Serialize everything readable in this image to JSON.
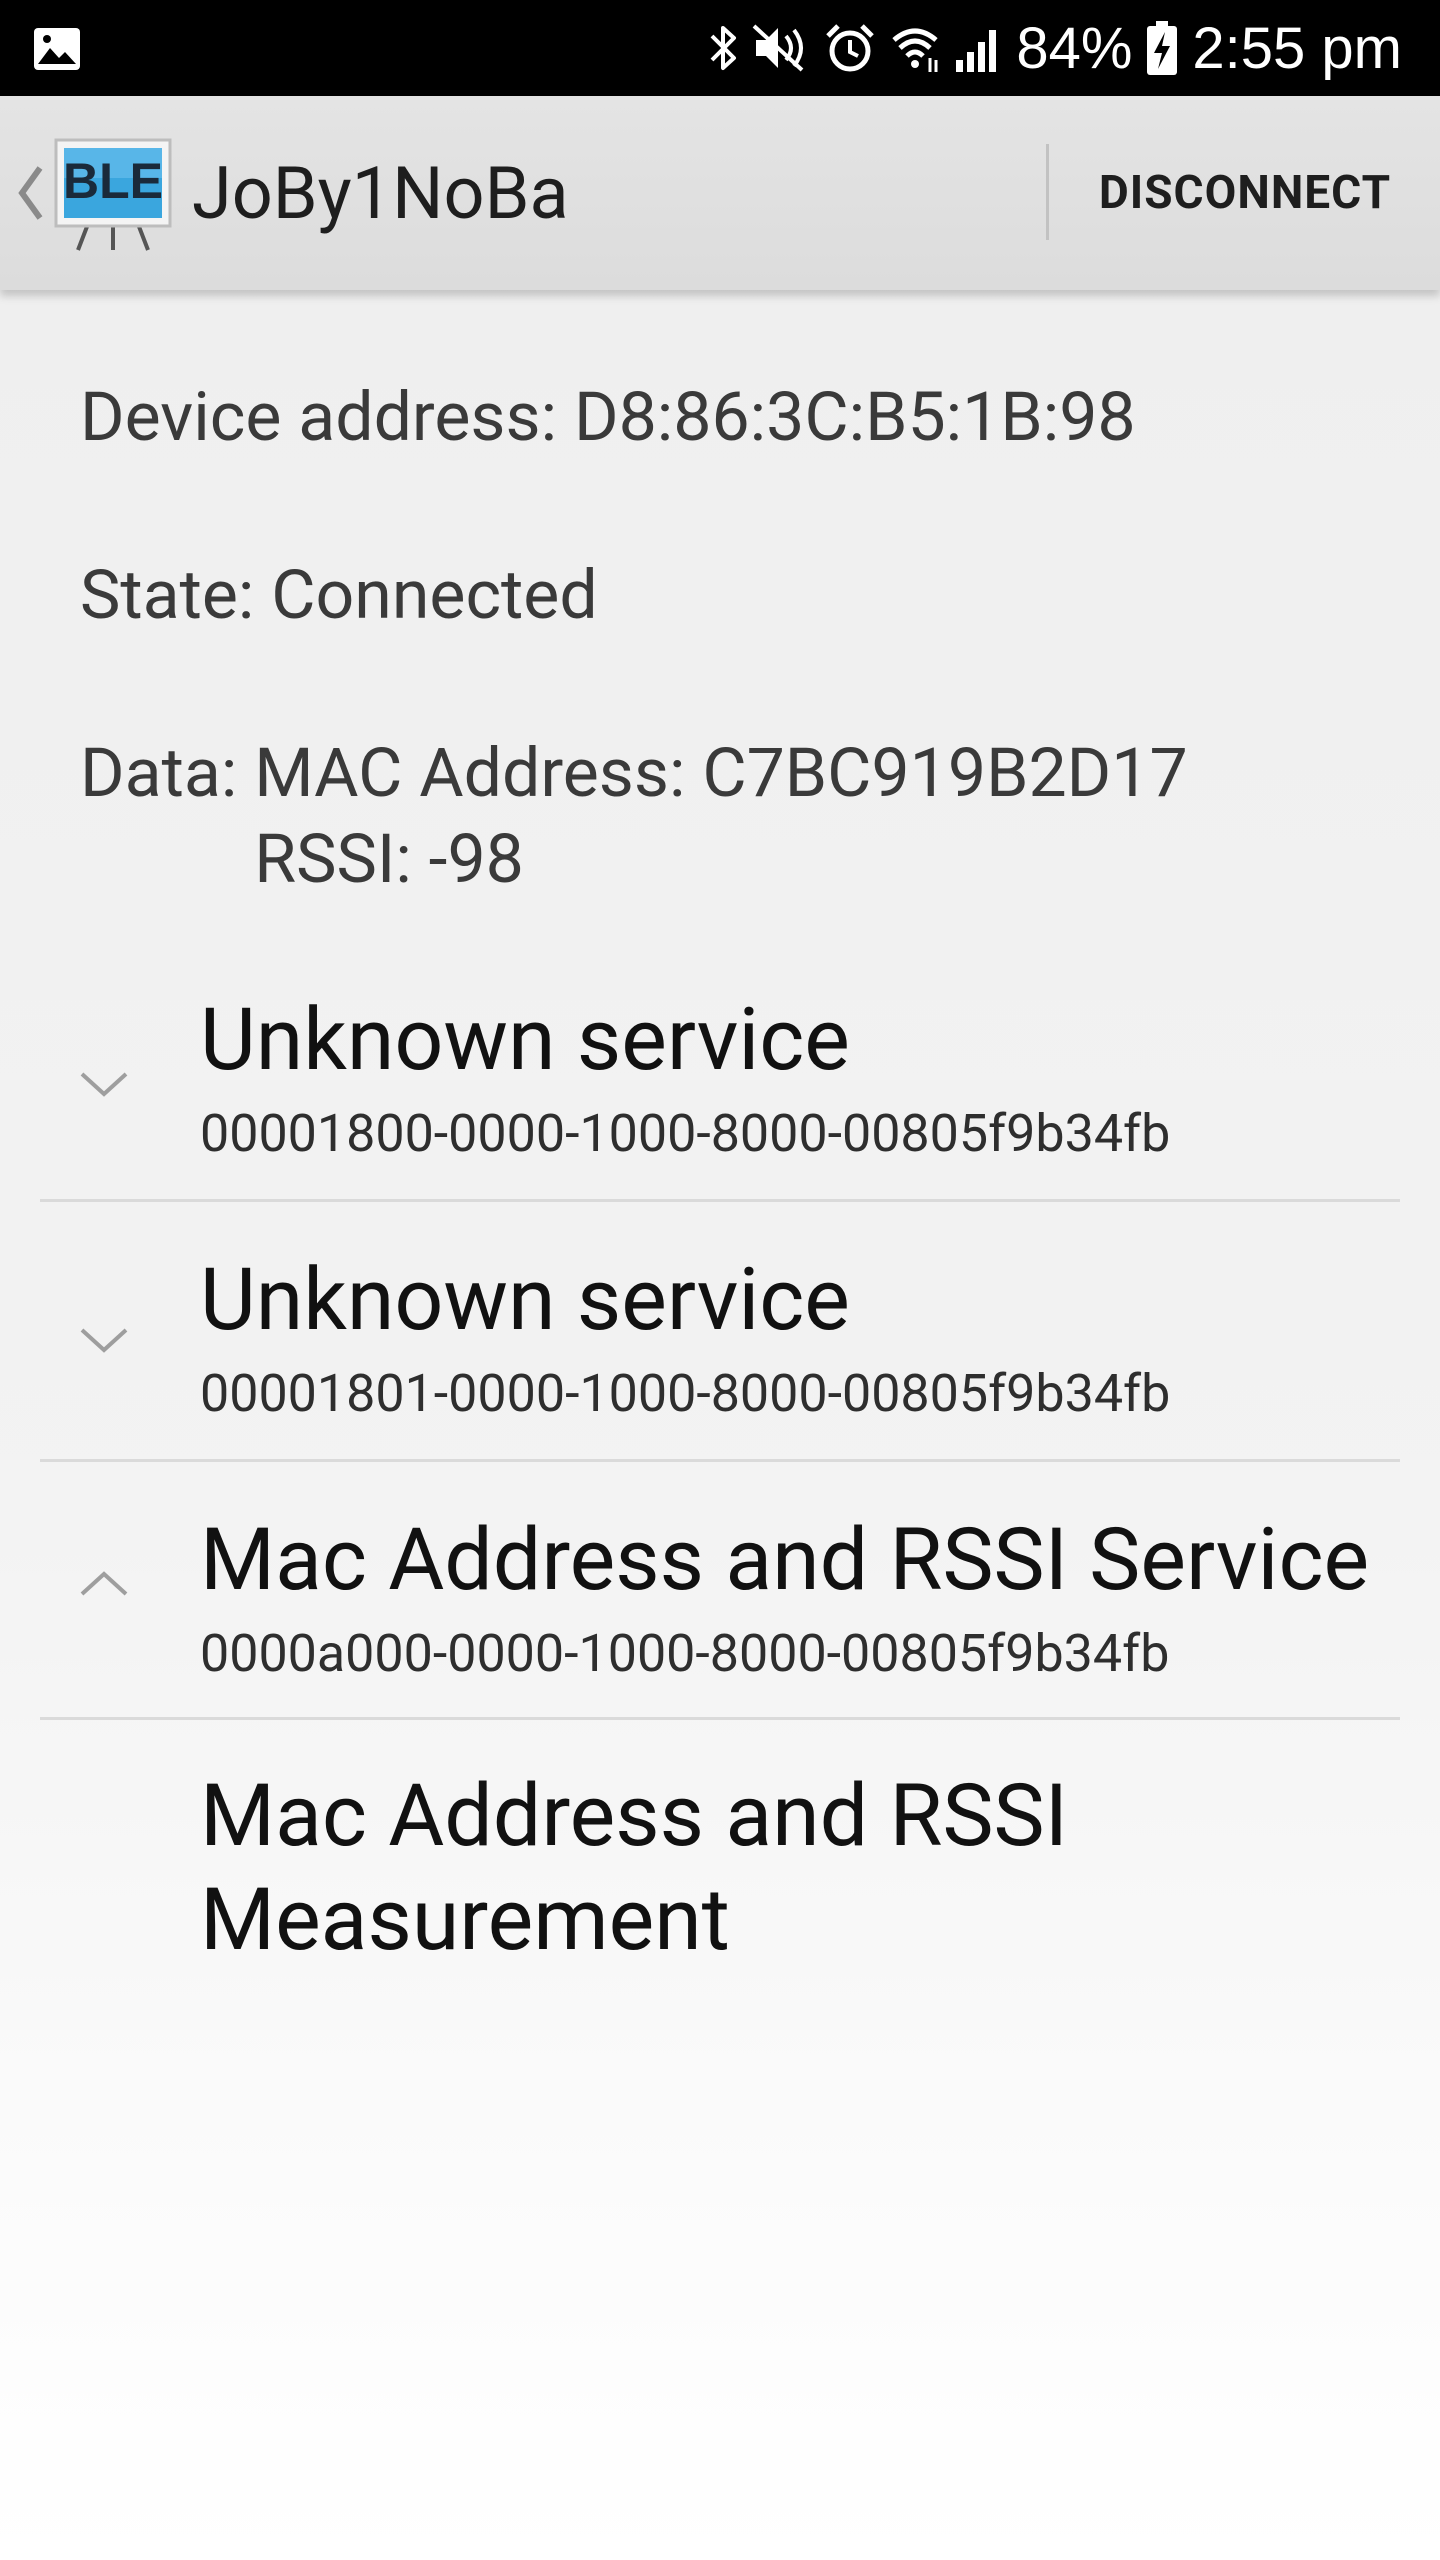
{
  "status_bar": {
    "battery": "84%",
    "time": "2:55 pm",
    "icons": [
      "gallery-icon",
      "bluetooth-icon",
      "mute-icon",
      "alarm-icon",
      "wifi-icon",
      "signal-icon",
      "battery-charging-icon"
    ]
  },
  "action_bar": {
    "logo_text": "BLE",
    "title": "JoBy1NoBa",
    "disconnect_label": "DISCONNECT"
  },
  "device": {
    "address_label": "Device address: ",
    "address": "D8:86:3C:B5:1B:98",
    "state_label": "State: ",
    "state": "Connected",
    "data_label": "Data: ",
    "data_line1": "MAC Address: C7BC919B2D17",
    "data_line2": "RSSI: -98"
  },
  "services": [
    {
      "name": "Unknown service",
      "uuid": "00001800-0000-1000-8000-00805f9b34fb",
      "expanded": false
    },
    {
      "name": "Unknown service",
      "uuid": "00001801-0000-1000-8000-00805f9b34fb",
      "expanded": false
    },
    {
      "name": "Mac Address and RSSI Service",
      "uuid": "0000a000-0000-1000-8000-00805f9b34fb",
      "expanded": true
    }
  ],
  "characteristic": {
    "name": "Mac Address and RSSI Measurement"
  },
  "colors": {
    "status_bar_bg": "#000000",
    "action_bar_bg": "#dcdcdc",
    "logo_blue": "#2f9fd8",
    "divider": "#dadada",
    "chevron": "#9e9e9e"
  }
}
